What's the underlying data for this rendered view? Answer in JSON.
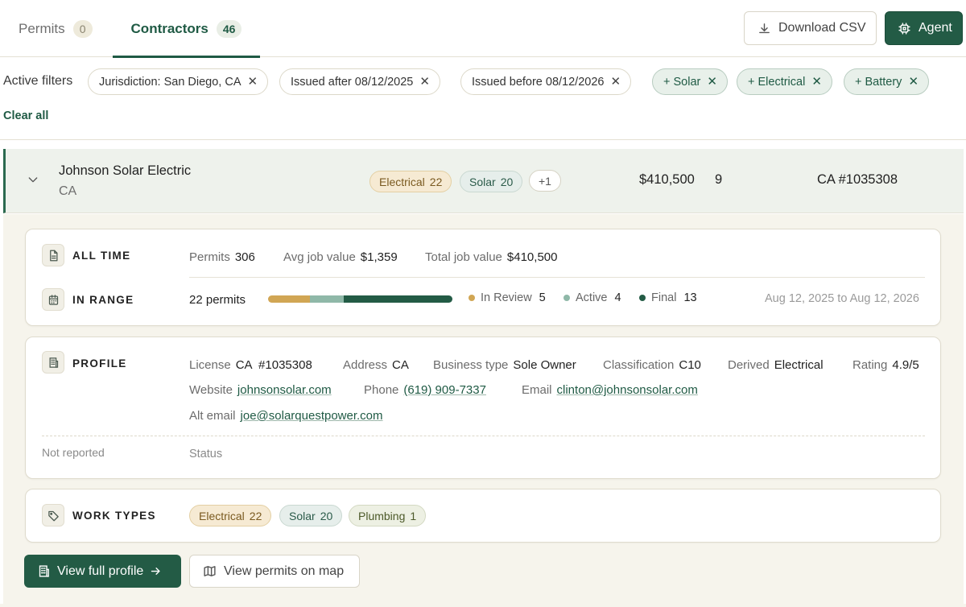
{
  "tabs": [
    {
      "label": "Permits",
      "count": "0"
    },
    {
      "label": "Contractors",
      "count": "46"
    }
  ],
  "header": {
    "download_label": "Download CSV",
    "agent_label": "Agent"
  },
  "filters": {
    "label": "Active filters",
    "chips": [
      "Jurisdiction: San Diego, CA",
      "Issued after 08/12/2025",
      "Issued before 08/12/2026",
      "+ Solar",
      "+ Electrical",
      "+ Battery"
    ],
    "clear_all": "Clear all"
  },
  "contractor": {
    "name": "Johnson Solar Electric",
    "state": "CA",
    "tags": [
      {
        "label": "Electrical",
        "count": "22"
      },
      {
        "label": "Solar",
        "count": "20"
      }
    ],
    "more": "+1",
    "total_value": "$410,500",
    "count": "9",
    "license": "CA #1035308"
  },
  "all_time": {
    "title": "ALL TIME",
    "permits_label": "Permits",
    "permits_value": "306",
    "avg_label": "Avg job value",
    "avg_value": "$1,359",
    "total_label": "Total job value",
    "total_value": "$410,500"
  },
  "in_range": {
    "title": "IN RANGE",
    "summary": "22 permits",
    "breakdown": [
      {
        "label": "In Review",
        "value": 5,
        "color": "#d1a654"
      },
      {
        "label": "Active",
        "value": 4,
        "color": "#8fb8a8"
      },
      {
        "label": "Final",
        "value": 13,
        "color": "#235b45"
      }
    ],
    "date_range": "Aug 12, 2025 to Aug 12, 2026"
  },
  "profile": {
    "title": "PROFILE",
    "license_label": "License",
    "license_value": "CA  #1035308",
    "address_label": "Address",
    "address_value": "CA",
    "business_label": "Business type",
    "business_value": "Sole Owner",
    "classification_label": "Classification",
    "classification_value": "C10",
    "derived_label": "Derived",
    "derived_value": "Electrical",
    "rating_label": "Rating",
    "rating_value": "4.9/5",
    "website_label": "Website",
    "website_value": "johnsonsolar.com",
    "phone_label": "Phone",
    "phone_value": "(619) 909-7337",
    "email_label": "Email",
    "email_value": "clinton@johnsonsolar.com",
    "alt_email_label": "Alt email",
    "alt_email_value": "joe@solarquestpower.com",
    "not_reported": "Not reported",
    "status_label": "Status"
  },
  "work_types": {
    "title": "WORK TYPES",
    "items": [
      {
        "label": "Electrical",
        "count": "22"
      },
      {
        "label": "Solar",
        "count": "20"
      },
      {
        "label": "Plumbing",
        "count": "1"
      }
    ]
  },
  "actions": {
    "view_profile": "View full profile",
    "view_map": "View permits on map"
  },
  "colors": {
    "brand": "#235b45",
    "accent_amber": "#d1a654",
    "row_highlight": "#eef2ec"
  }
}
